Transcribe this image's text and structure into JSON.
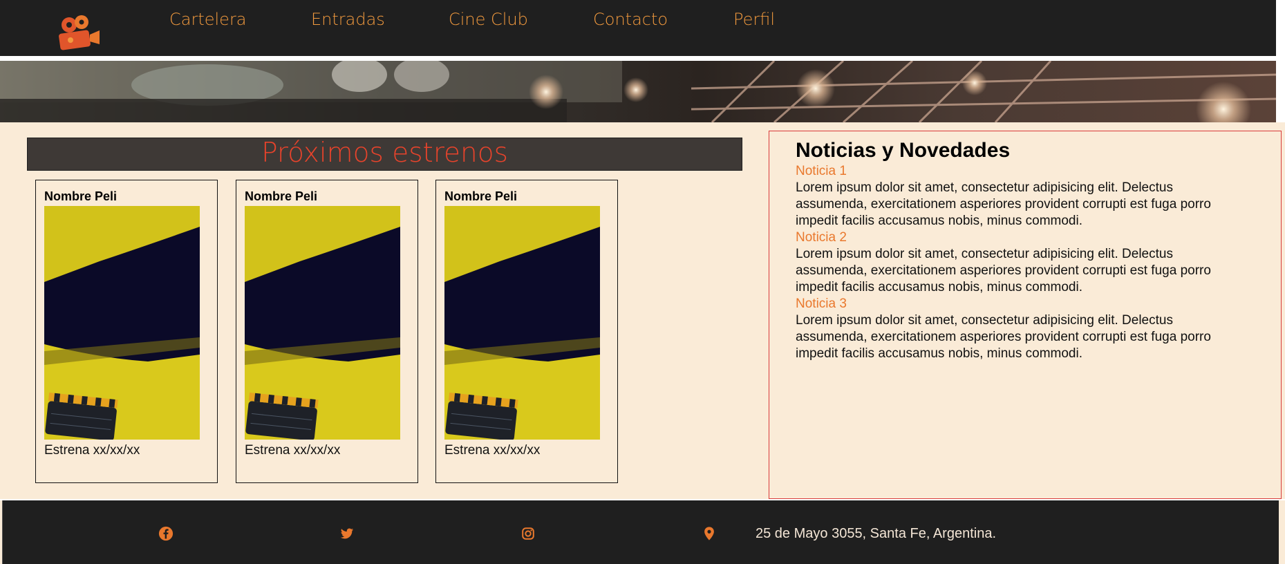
{
  "nav": {
    "links": [
      "Cartelera",
      "Entradas",
      "Cine Club",
      "Contacto",
      "Perfil"
    ]
  },
  "releases": {
    "title": "Próximos estrenos",
    "cards": [
      {
        "name": "Nombre Peli",
        "date": "Estrena xx/xx/xx"
      },
      {
        "name": "Nombre Peli",
        "date": "Estrena xx/xx/xx"
      },
      {
        "name": "Nombre Peli",
        "date": "Estrena xx/xx/xx"
      }
    ]
  },
  "news": {
    "title": "Noticias y Novedades",
    "items": [
      {
        "title": "Noticia 1",
        "body": "Lorem ipsum dolor sit amet, consectetur adipisicing elit. Delectus assumenda, exercitationem asperiores provident corrupti est fuga porro impedit facilis accusamus nobis, minus commodi."
      },
      {
        "title": "Noticia 2",
        "body": "Lorem ipsum dolor sit amet, consectetur adipisicing elit. Delectus assumenda, exercitationem asperiores provident corrupti est fuga porro impedit facilis accusamus nobis, minus commodi."
      },
      {
        "title": "Noticia 3",
        "body": "Lorem ipsum dolor sit amet, consectetur adipisicing elit. Delectus assumenda, exercitationem asperiores provident corrupti est fuga porro impedit facilis accusamus nobis, minus commodi."
      }
    ]
  },
  "footer": {
    "icons": [
      "facebook-icon",
      "twitter-icon",
      "instagram-icon",
      "location-pin-icon"
    ],
    "address": "25 de Mayo 3055, Santa Fe, Argentina."
  },
  "colors": {
    "nav_bg": "#1f1f1f",
    "accent_orange": "#f29a3e",
    "title_red": "#e8432b",
    "page_bg": "#faebd7",
    "news_border": "#d93a3a"
  }
}
